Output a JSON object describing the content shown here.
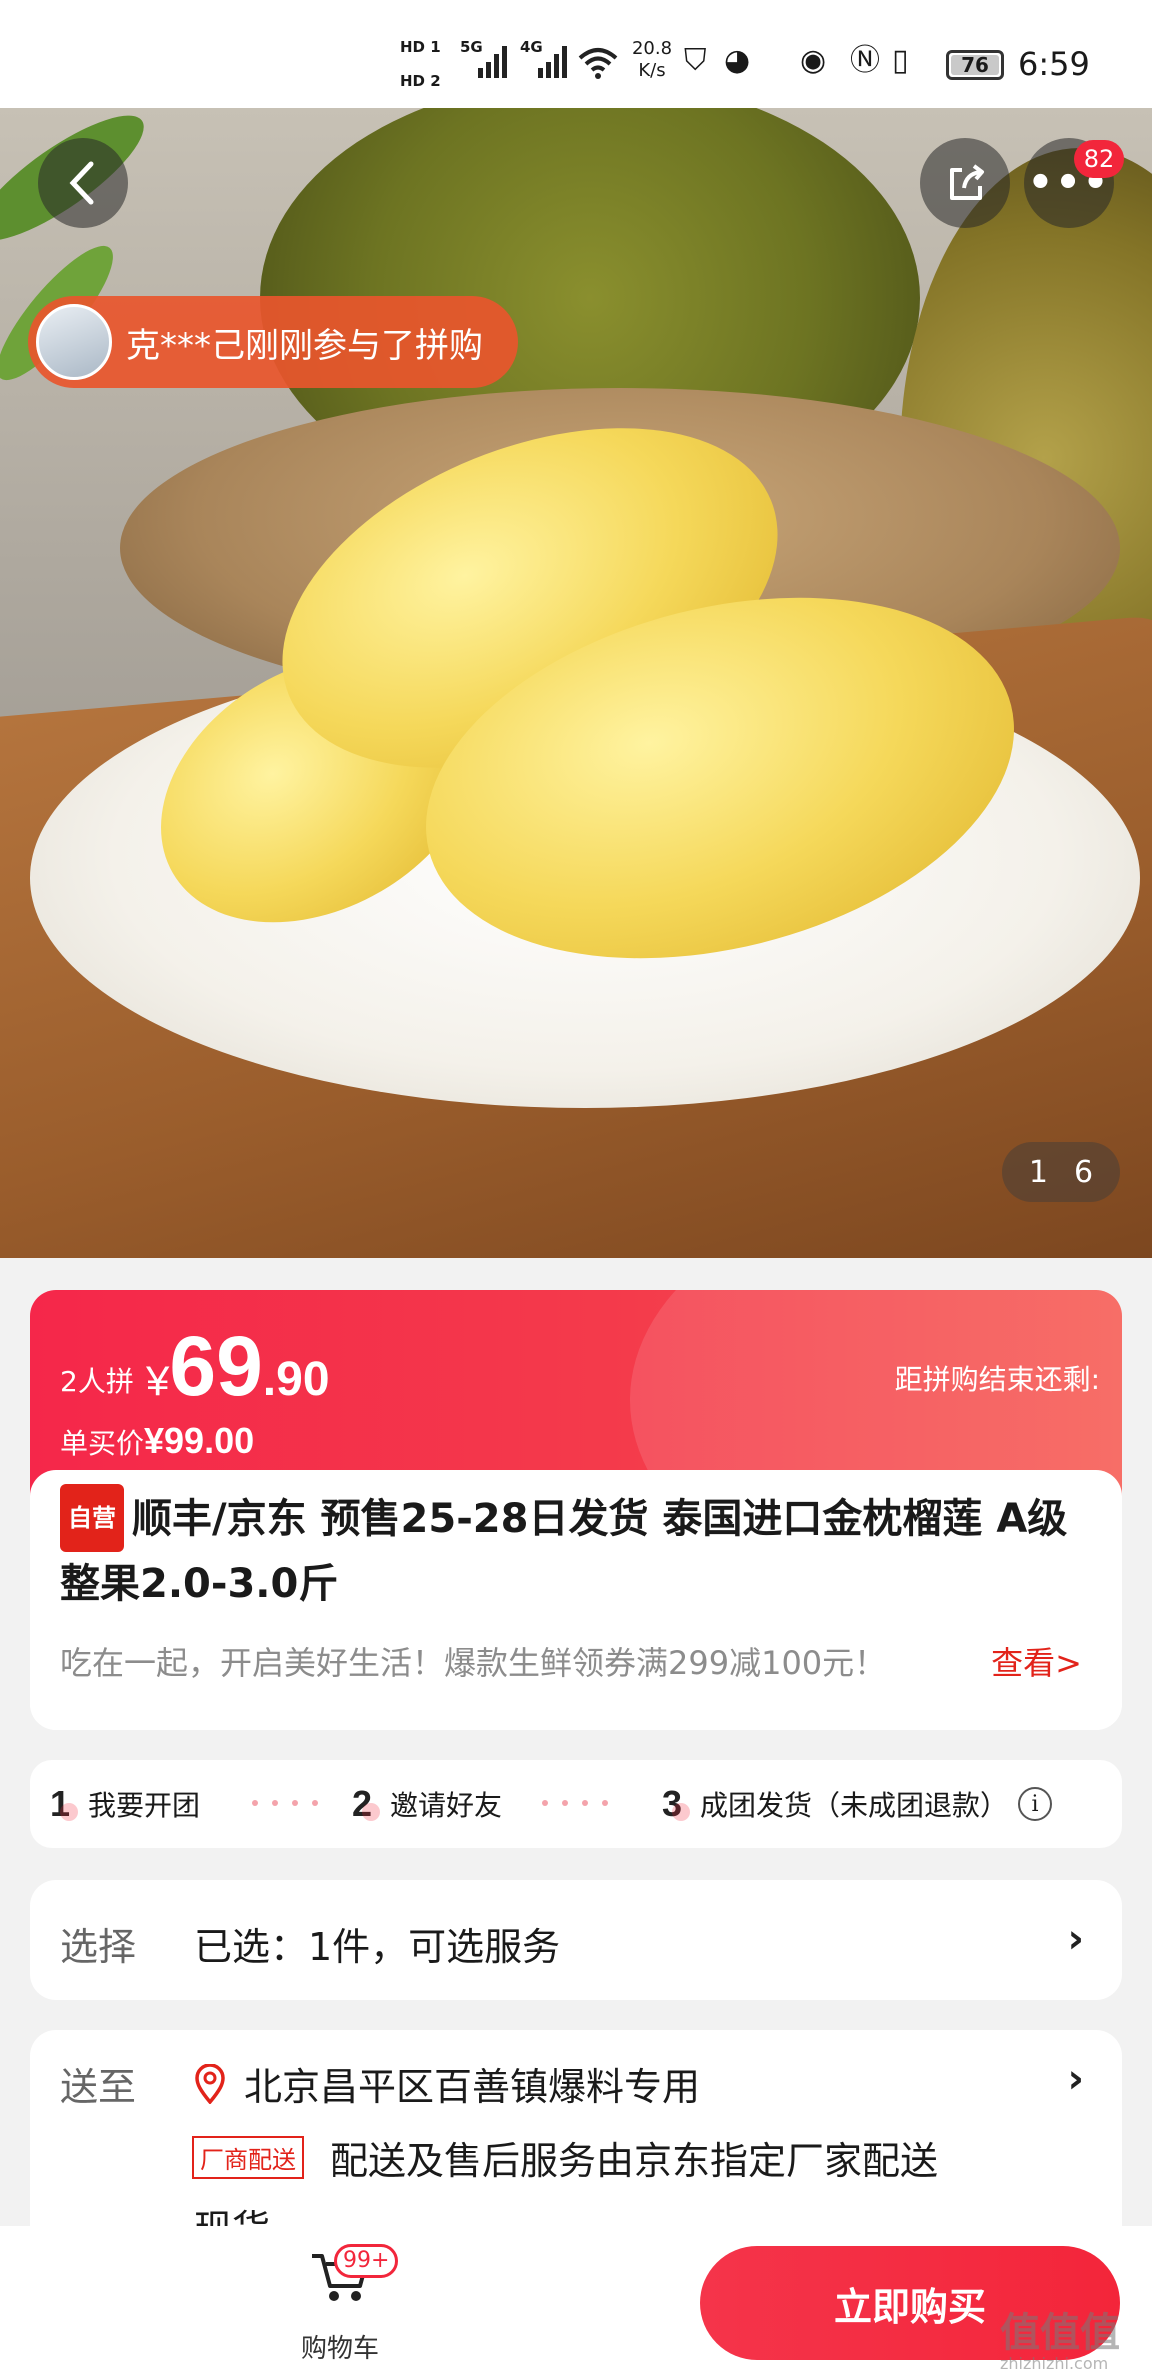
{
  "status_bar": {
    "sim1": "HD 1",
    "sim2": "HD 2",
    "net1": "5G",
    "net2": "4G",
    "speed_value": "20.8",
    "speed_unit": "K/s",
    "battery": "76",
    "time": "6:59"
  },
  "hero": {
    "more_badge": "82",
    "join_notice": "克***己刚刚参与了拼购",
    "image_index": "1",
    "image_total": "6"
  },
  "price": {
    "group_label": "2人拼",
    "currency": "¥",
    "group_price_int": "69",
    "group_price_dec": ".90",
    "single_label": "单买价",
    "single_price": "¥99.00",
    "countdown_label": "距拼购结束还剩:"
  },
  "product": {
    "self_tag": "自营",
    "title": "顺丰/京东 预售25-28日发货 泰国进口金枕榴莲 A级整果2.0-3.0斤",
    "promo": "吃在一起，开启美好生活！爆款生鲜领券满299减100元！",
    "promo_link": "查看>"
  },
  "steps": [
    {
      "num": "1",
      "label": "我要开团"
    },
    {
      "num": "2",
      "label": "邀请好友"
    },
    {
      "num": "3",
      "label": "成团发货（未成团退款）"
    }
  ],
  "select": {
    "label": "选择",
    "value": "已选：1件，可选服务"
  },
  "delivery": {
    "label": "送至",
    "address": "北京昌平区百善镇爆料专用",
    "factory_tag": "厂商配送",
    "factory_text": "配送及售后服务由京东指定厂家配送",
    "stock": "现货"
  },
  "bottom": {
    "cart_badge": "99+",
    "cart_label": "购物车",
    "buy_label": "立即购买"
  },
  "watermark": {
    "logo": "值值值",
    "site": "zhizhizhi.com"
  },
  "colors": {
    "accent_red": "#f2263b",
    "self_tag_red": "#e2231a"
  }
}
